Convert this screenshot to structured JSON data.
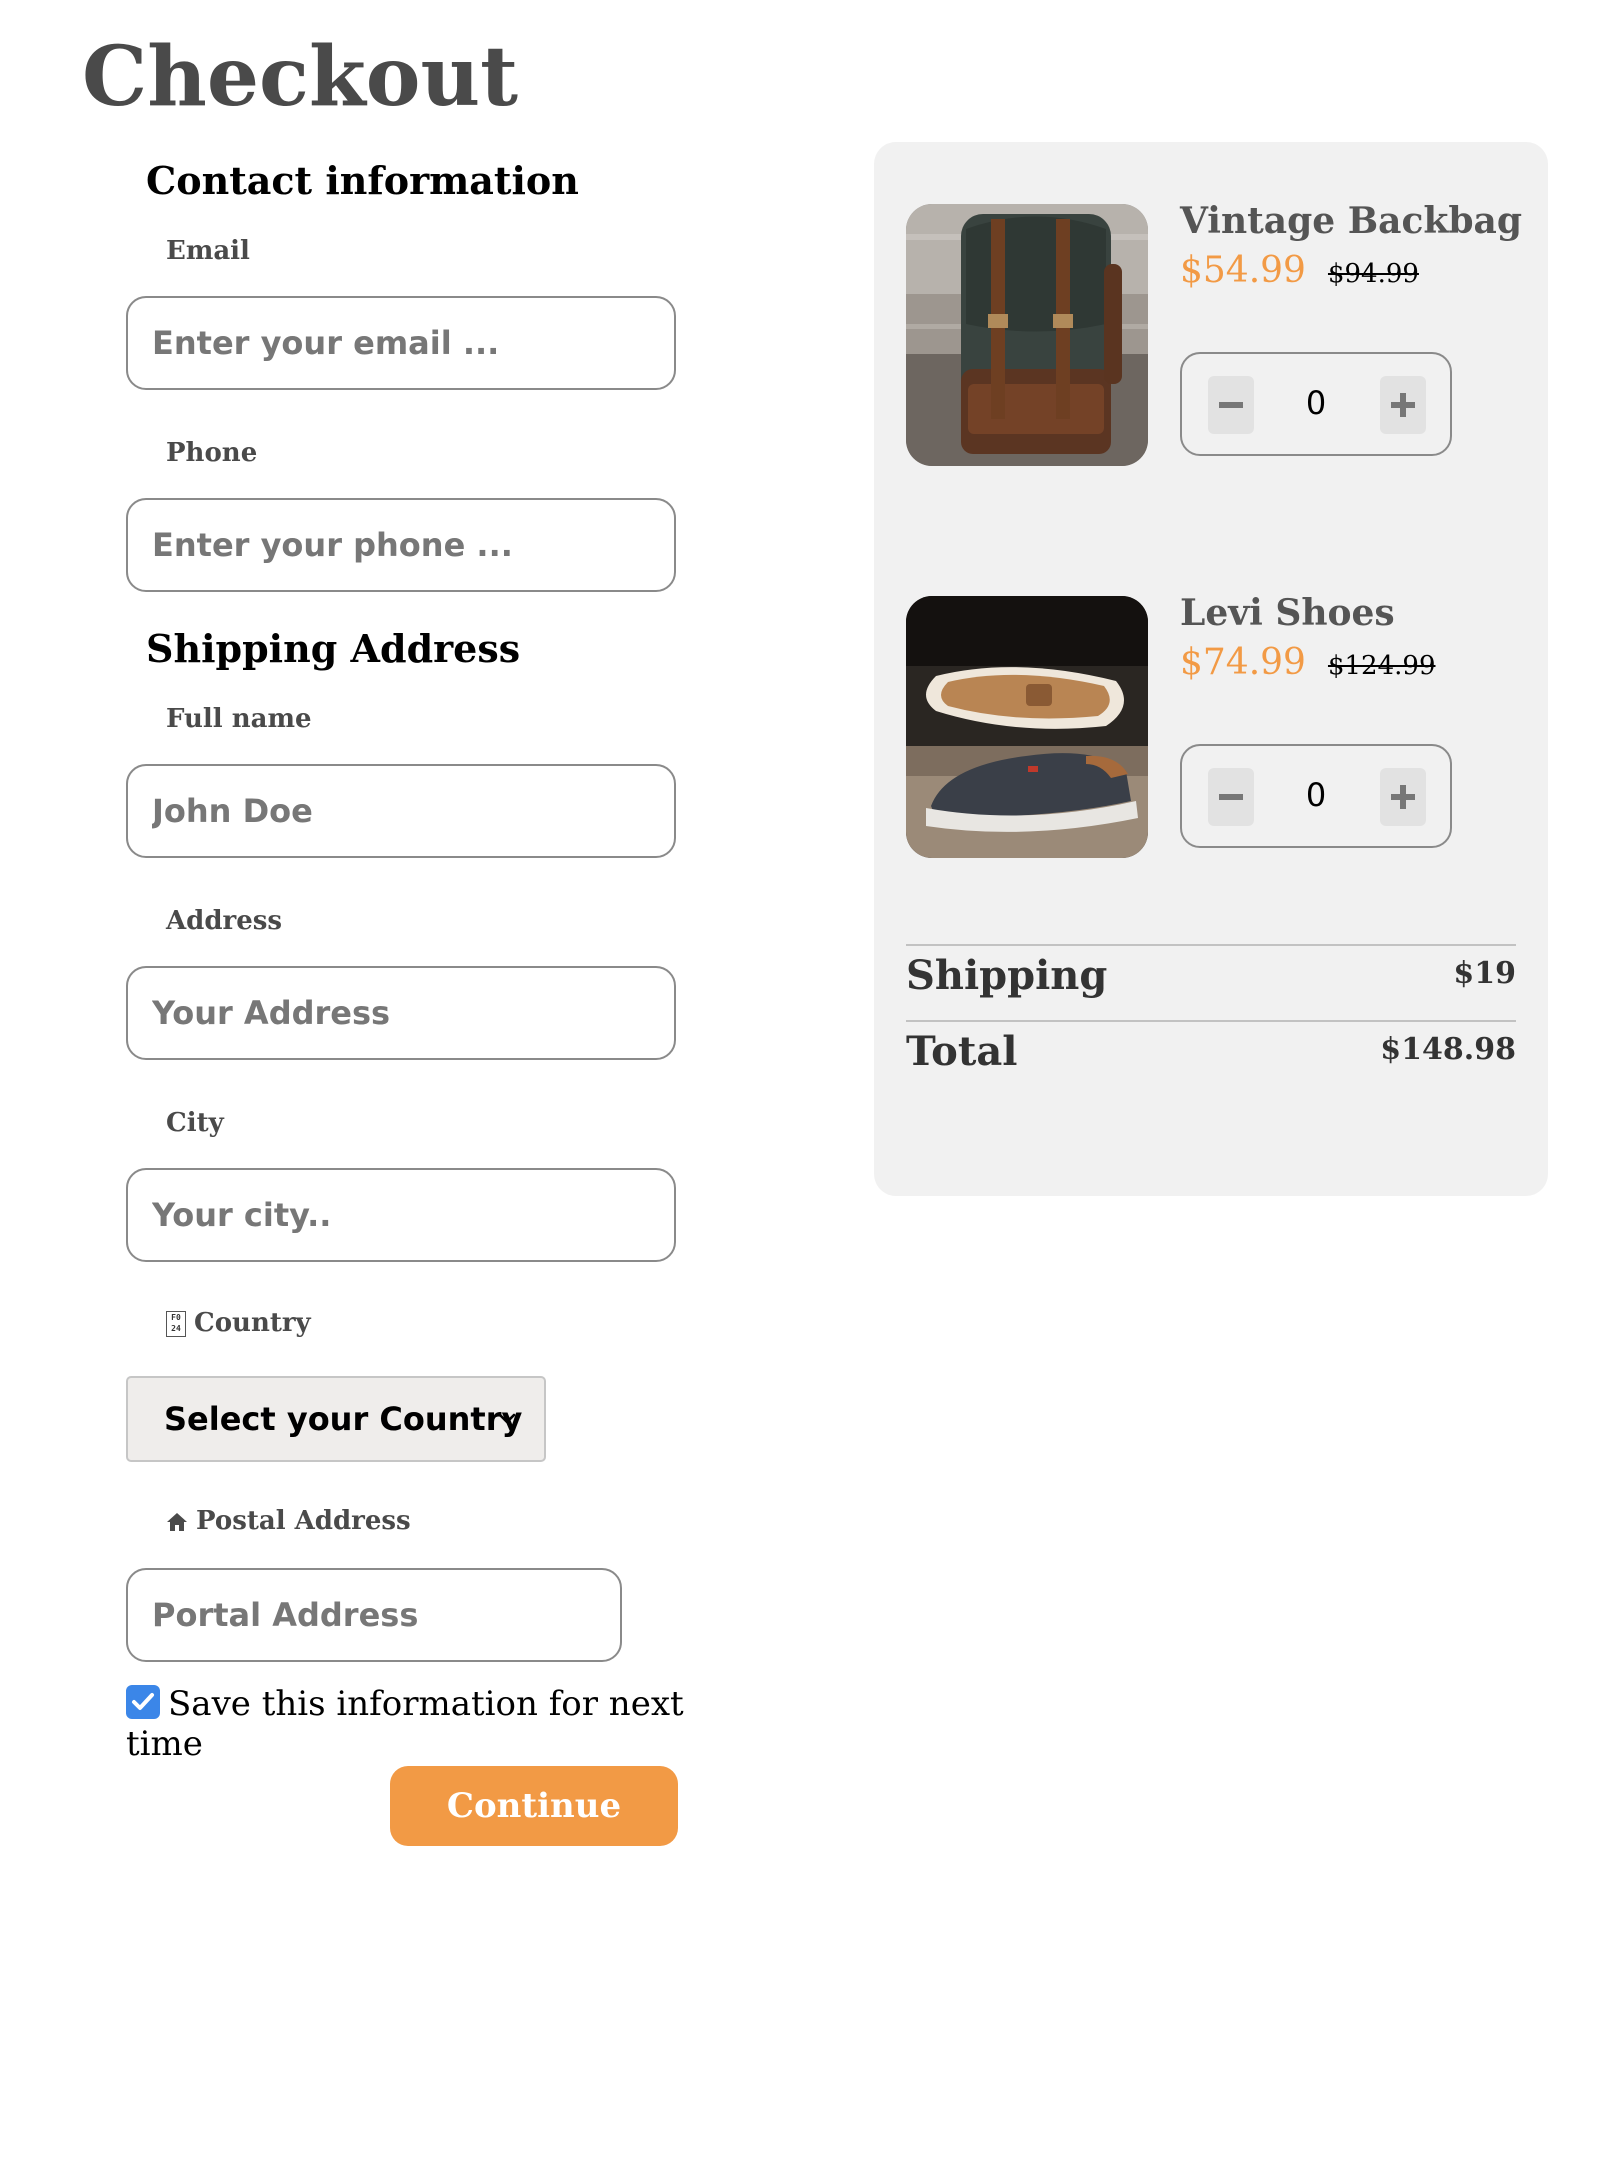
{
  "page": {
    "title": "Checkout"
  },
  "contact": {
    "heading": "Contact information",
    "email": {
      "label": "Email",
      "placeholder": "Enter your email ..."
    },
    "phone": {
      "label": "Phone",
      "placeholder": "Enter your phone ..."
    }
  },
  "shipping": {
    "heading": "Shipping Address",
    "full_name": {
      "label": "Full name",
      "placeholder": "John Doe"
    },
    "address": {
      "label": "Address",
      "placeholder": "Your Address"
    },
    "city": {
      "label": "City",
      "placeholder": "Your city.."
    },
    "country": {
      "label": "Country",
      "selected": "Select your Country",
      "icon": "missing-glyph-icon"
    },
    "postal": {
      "label": "Postal Address",
      "placeholder": "Portal Address",
      "icon": "home-icon"
    }
  },
  "save_info": {
    "label": "Save this information for next time",
    "checked": true
  },
  "continue_label": "Continue",
  "cart": {
    "items": [
      {
        "name": "Vintage Backbag",
        "price": "$54.99",
        "old_price": "$94.99",
        "quantity": "0"
      },
      {
        "name": "Levi Shoes",
        "price": "$74.99",
        "old_price": "$124.99",
        "quantity": "0"
      }
    ],
    "shipping_label": "Shipping",
    "shipping_value": "$19",
    "total_label": "Total",
    "total_value": "$148.98"
  },
  "colors": {
    "accent": "#f29a45",
    "checkbox": "#3b86e8",
    "panel": "#f1f1f1"
  }
}
